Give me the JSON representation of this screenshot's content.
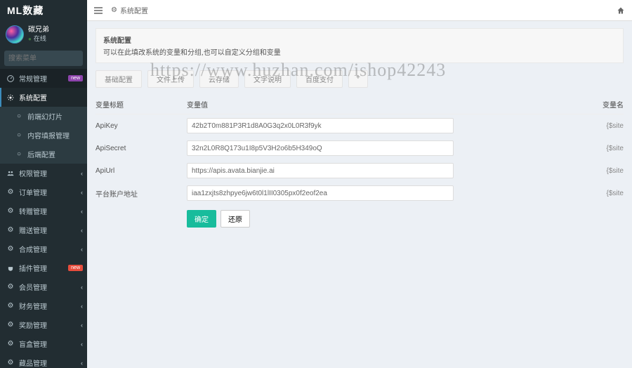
{
  "brand": "ML数藏",
  "user": {
    "name": "碳兄弟",
    "status": "在线"
  },
  "search": {
    "placeholder": "搜索菜单"
  },
  "topbar": {
    "title": "系统配置"
  },
  "watermark": "https://www.huzhan.com/ishop42243",
  "alert": {
    "title": "系统配置",
    "text": "可以在此填改系统的变量和分组,也可以自定义分组和变量"
  },
  "tabs": {
    "items": [
      "基础配置",
      "文件上传",
      "云存储",
      "文字说明",
      "百度支付"
    ],
    "plus": "+"
  },
  "table": {
    "col_label": "变量标题",
    "col_value": "变量值",
    "col_extra": "变量名"
  },
  "rows": [
    {
      "label": "ApiKey",
      "value": "42b2T0m881P3R1d8A0G3q2x0L0R3f9yk",
      "extra": "{$site"
    },
    {
      "label": "ApiSecret",
      "value": "32n2L0R8Q173u1I8p5V3H2o6b5H349oQ",
      "extra": "{$site"
    },
    {
      "label": "ApiUrl",
      "value": "https://apis.avata.bianjie.ai",
      "extra": "{$site"
    },
    {
      "label": "平台账户地址",
      "value": "iaa1zxjts8zhpye6jw6t0l1lII0305px0f2eof2ea",
      "extra": "{$site"
    }
  ],
  "buttons": {
    "ok": "确定",
    "reset": "还原"
  },
  "menu": {
    "changgui": {
      "label": "常规管理",
      "badge": "new"
    },
    "xitong": "系统配置",
    "sub1": "前端幻灯片",
    "sub2": "内容填报管理",
    "sub3": "后端配置",
    "quanxian": "权限管理",
    "dingdan": "订单管理",
    "zhuanzeng": "转赠管理",
    "zengsong": "赠送管理",
    "hecheng": "合成管理",
    "chajian": {
      "label": "插件管理",
      "badge": "new"
    },
    "huiyuan": "会员管理",
    "caiwu": "财务管理",
    "jiangli": "奖励管理",
    "manghe": "盲盒管理",
    "cangpin": "藏品管理"
  },
  "colors": {
    "accent": "#18bc9c",
    "sidebar": "#222d32"
  }
}
